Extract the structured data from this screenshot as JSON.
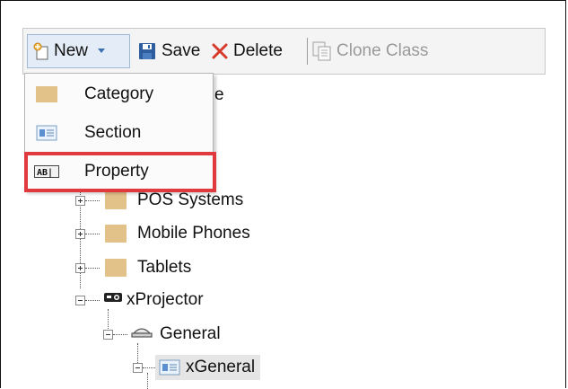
{
  "toolbar": {
    "new_label": "New",
    "save_label": "Save",
    "delete_label": "Delete",
    "clone_label": "Clone Class"
  },
  "new_menu": {
    "items": [
      {
        "label": "Category",
        "icon": "folder-icon"
      },
      {
        "label": "Section",
        "icon": "section-icon"
      },
      {
        "label": "Property",
        "icon": "property-icon",
        "highlighted": true
      }
    ]
  },
  "tree": {
    "partial_root_suffix": "e",
    "items": [
      {
        "label": "POS Systems",
        "icon": "folder-icon",
        "expander": "plus"
      },
      {
        "label": "Mobile Phones",
        "icon": "folder-icon",
        "expander": "plus"
      },
      {
        "label": "Tablets",
        "icon": "folder-icon",
        "expander": "plus"
      },
      {
        "label": "xProjector",
        "icon": "projector-icon",
        "expander": "minus"
      },
      {
        "label": "General",
        "icon": "group-icon",
        "expander": "minus"
      },
      {
        "label": "xGeneral",
        "icon": "section-icon",
        "expander": "minus",
        "selected": true
      }
    ]
  },
  "colors": {
    "highlight_border": "#e03a3e",
    "new_button_bg": "#e4edf7",
    "selection_bg": "#e5e5e5",
    "folder": "#e3c28a",
    "save_icon": "#2f5e9e",
    "delete_icon": "#d73a2a"
  }
}
